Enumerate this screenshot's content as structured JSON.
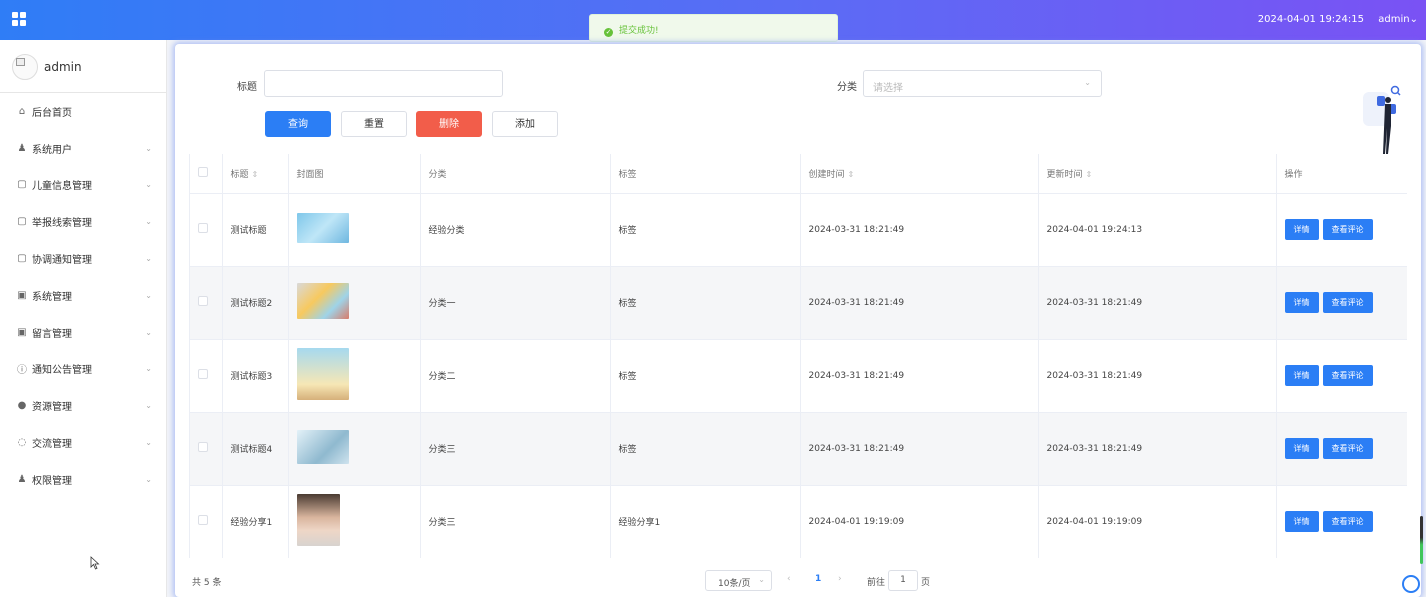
{
  "topbar": {
    "datetime": "2024-04-01 19:24:15",
    "user": "admin",
    "user_caret": "⌄"
  },
  "toast": {
    "message": "提交成功!"
  },
  "sidebar": {
    "username": "admin",
    "items": [
      {
        "label": "后台首页",
        "icon": "home-icon",
        "glyph": "⌂",
        "has_children": false
      },
      {
        "label": "系统用户",
        "icon": "user-icon",
        "glyph": "♟",
        "has_children": true
      },
      {
        "label": "儿童信息管理",
        "icon": "document-icon",
        "glyph": "▢",
        "has_children": true
      },
      {
        "label": "举报线索管理",
        "icon": "document-icon",
        "glyph": "▢",
        "has_children": true
      },
      {
        "label": "协调通知管理",
        "icon": "document-icon",
        "glyph": "▢",
        "has_children": true
      },
      {
        "label": "系统管理",
        "icon": "picture-icon",
        "glyph": "▣",
        "has_children": true
      },
      {
        "label": "留言管理",
        "icon": "picture-icon",
        "glyph": "▣",
        "has_children": true
      },
      {
        "label": "通知公告管理",
        "icon": "info-icon",
        "glyph": "ⓘ",
        "has_children": true
      },
      {
        "label": "资源管理",
        "icon": "location-icon",
        "glyph": "●",
        "has_children": true
      },
      {
        "label": "交流管理",
        "icon": "chat-icon",
        "glyph": "◌",
        "has_children": true
      },
      {
        "label": "权限管理",
        "icon": "user-icon",
        "glyph": "♟",
        "has_children": true
      }
    ]
  },
  "filters": {
    "title_label": "标题",
    "title_value": "",
    "category_label": "分类",
    "category_placeholder": "请选择"
  },
  "buttons": {
    "query": "查询",
    "reset": "重置",
    "delete": "删除",
    "add": "添加"
  },
  "table": {
    "headers": [
      "标题",
      "封面图",
      "分类",
      "标签",
      "创建时间",
      "更新时间",
      "操作"
    ],
    "rows": [
      {
        "title": "测试标题",
        "category": "经验分类",
        "tag": "标签",
        "created": "2024-03-31 18:21:49",
        "updated": "2024-04-01 19:24:13"
      },
      {
        "title": "测试标题2",
        "category": "分类一",
        "tag": "标签",
        "created": "2024-03-31 18:21:49",
        "updated": "2024-03-31 18:21:49"
      },
      {
        "title": "测试标题3",
        "category": "分类二",
        "tag": "标签",
        "created": "2024-03-31 18:21:49",
        "updated": "2024-03-31 18:21:49"
      },
      {
        "title": "测试标题4",
        "category": "分类三",
        "tag": "标签",
        "created": "2024-03-31 18:21:49",
        "updated": "2024-03-31 18:21:49"
      },
      {
        "title": "经验分享1",
        "category": "分类三",
        "tag": "经验分享1",
        "created": "2024-04-01 19:19:09",
        "updated": "2024-04-01 19:19:09"
      }
    ],
    "actions": {
      "detail": "详情",
      "comments": "查看评论"
    }
  },
  "pagination": {
    "total": "共 5 条",
    "page_size": "10条/页",
    "current_page": "1",
    "goto_label": "前往",
    "goto_value": "1",
    "page_suffix": "页"
  },
  "colors": {
    "primary": "#2b7ef5",
    "danger": "#f25d4a",
    "success": "#67c23a"
  }
}
